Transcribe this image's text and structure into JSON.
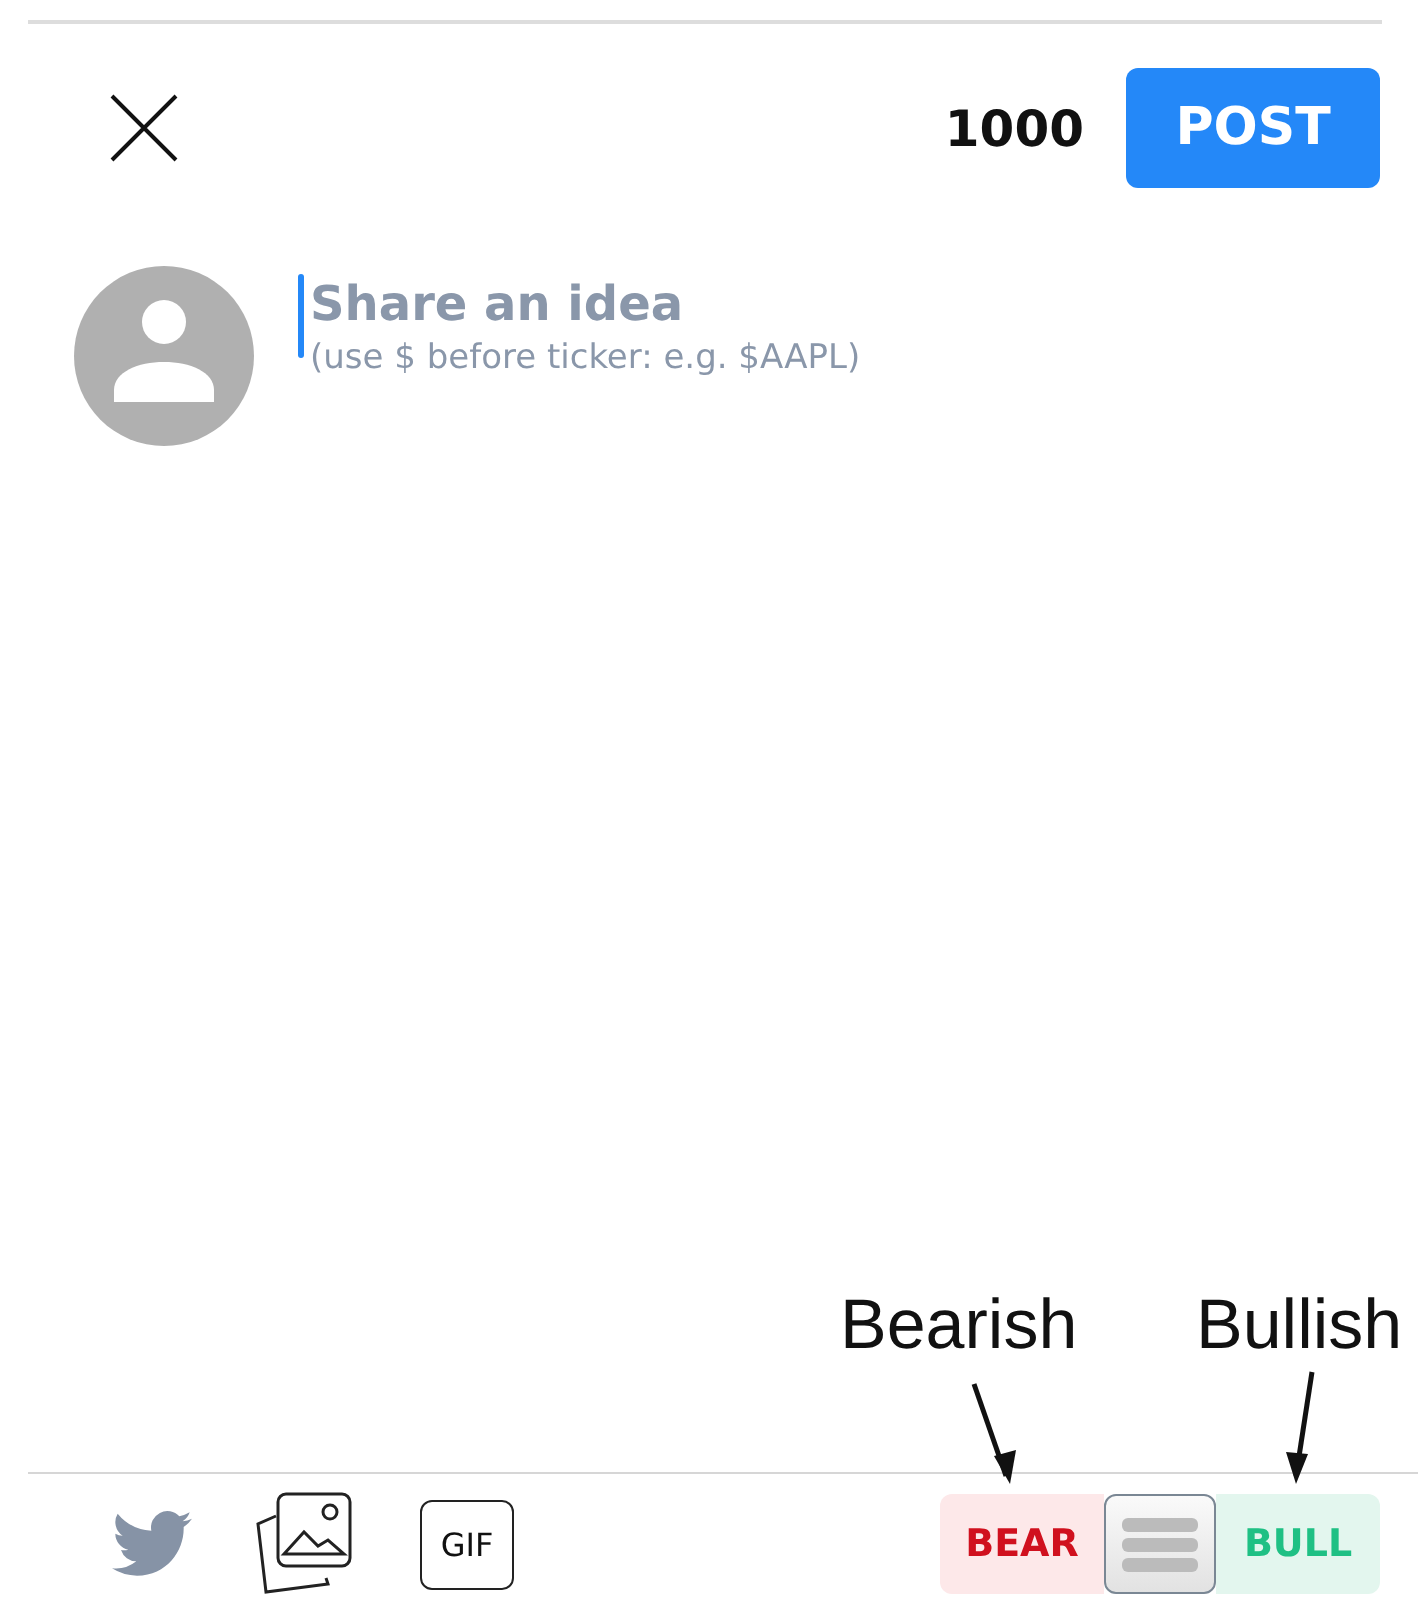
{
  "header": {
    "char_count": "1000",
    "post_button": "POST"
  },
  "composer": {
    "placeholder": "Share an idea",
    "hint": "(use $ before ticker: e.g. $AAPL)"
  },
  "toolbar": {
    "gif_label": "GIF"
  },
  "sentiment": {
    "options": [
      {
        "kind": "bear",
        "label": "BEAR",
        "selected": false
      },
      {
        "kind": "bull",
        "label": "BULL",
        "selected": false
      }
    ]
  },
  "annotations": [
    {
      "kind": "bear",
      "text": "Bearish"
    },
    {
      "kind": "bull",
      "text": "Bullish"
    }
  ]
}
